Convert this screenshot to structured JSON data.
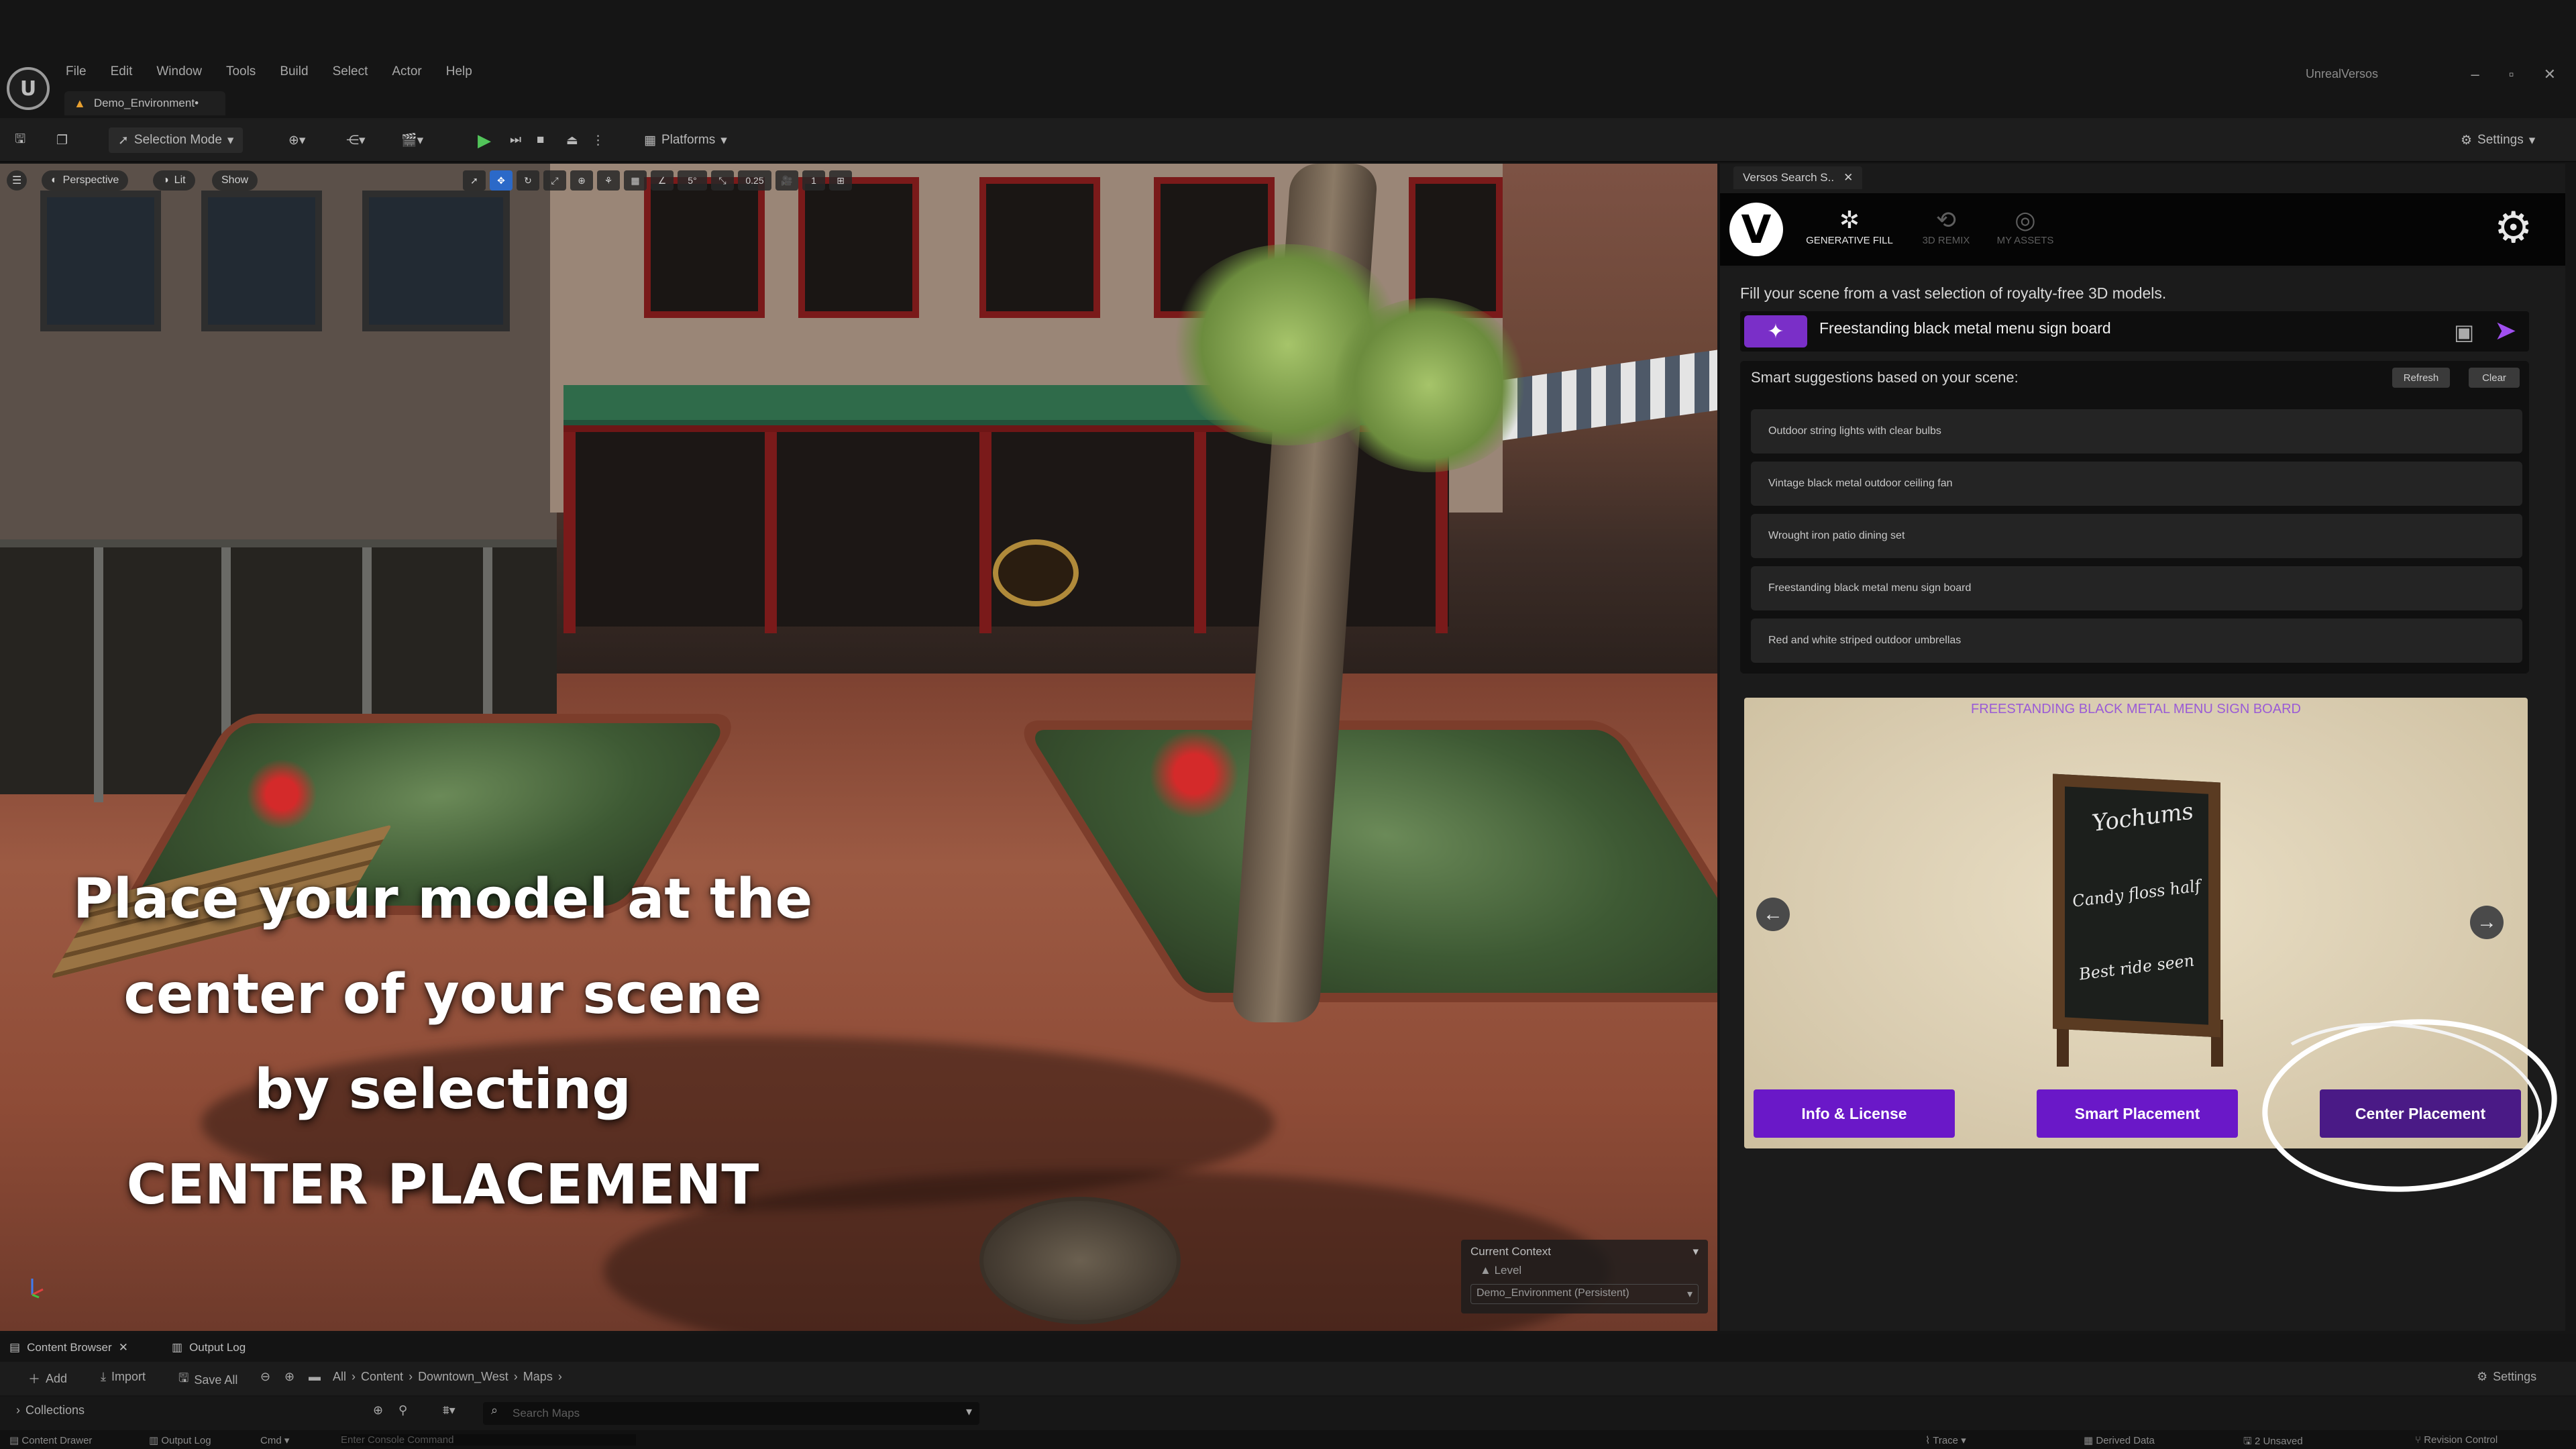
{
  "menubar": {
    "items": [
      "File",
      "Edit",
      "Window",
      "Tools",
      "Build",
      "Select",
      "Actor",
      "Help"
    ],
    "app_title": "UnrealVersos",
    "window_controls": [
      "–",
      "▫",
      "✕"
    ]
  },
  "document_tab": {
    "label": "Demo_Environment•"
  },
  "toolbar": {
    "selection_mode": "Selection Mode",
    "platforms": "Platforms",
    "settings": "Settings"
  },
  "viewport": {
    "perspective": "Perspective",
    "lit": "Lit",
    "show": "Show",
    "snap_value": "0.25",
    "camera_speed": "1",
    "grid_value": "5°"
  },
  "caption": {
    "lines": [
      "Place your model at the",
      "center of your scene",
      "by selecting",
      "CENTER PLACEMENT"
    ]
  },
  "current_context": {
    "title": "Current Context",
    "level_label": "Level",
    "level_value": "Demo_Environment (Persistent)"
  },
  "panel": {
    "tab_label": "Versos Search S..",
    "nav": [
      {
        "label": "GENERATIVE FILL",
        "icon": "generative-fill-icon"
      },
      {
        "label": "3D REMIX",
        "icon": "remix-icon"
      },
      {
        "label": "MY ASSETS",
        "icon": "my-assets-icon"
      }
    ],
    "intro": "Fill your scene from a vast selection of royalty-free 3D models.",
    "search_value": "Freestanding black metal menu sign board",
    "suggestions_title": "Smart suggestions based on your scene:",
    "refresh_label": "Refresh",
    "clear_label": "Clear",
    "suggestions": [
      "Outdoor string lights with clear bulbs",
      "Vintage black metal outdoor ceiling fan",
      "Wrought iron patio dining set",
      "Freestanding black metal menu sign board",
      "Red and white striped outdoor umbrellas"
    ],
    "preview_title": "FREESTANDING BLACK METAL MENU SIGN BOARD",
    "sign_text": [
      "Yochums",
      "Candy floss half",
      "Best ride seen"
    ],
    "buttons": {
      "info": "Info & License",
      "smart": "Smart Placement",
      "center": "Center Placement"
    }
  },
  "bottom": {
    "tabs": [
      "Content Browser",
      "Output Log"
    ],
    "toolbar": {
      "add": "Add",
      "import": "Import",
      "save_all": "Save All",
      "breadcrumb": [
        "All",
        "Content",
        "Downtown_West",
        "Maps"
      ],
      "settings": "Settings"
    },
    "collections": "Collections",
    "search_placeholder": "Search Maps",
    "status": {
      "content_drawer": "Content Drawer",
      "output_log": "Output Log",
      "cmd": "Cmd",
      "console_placeholder": "Enter Console Command",
      "trace": "Trace",
      "derived_data": "Derived Data",
      "unsaved": "2 Unsaved",
      "revision": "Revision Control"
    }
  },
  "colors": {
    "accent_purple": "#6a18c8",
    "accent_purple_dark": "#4a1a86",
    "play_green": "#52c45a",
    "preview_title": "#9a5bd6"
  }
}
